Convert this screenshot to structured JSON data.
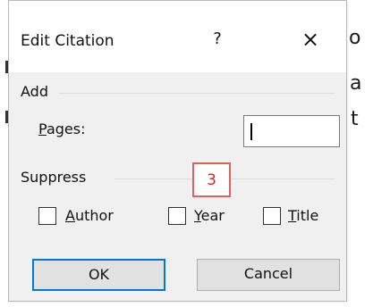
{
  "background": {
    "lines": [
      "o",
      "a",
      "t"
    ]
  },
  "dialog": {
    "title": "Edit Citation",
    "help_glyph": "?",
    "close_glyph": "×",
    "add_group": "Add",
    "pages_label_u": "P",
    "pages_label_rest": "ages:",
    "pages_value": "",
    "suppress_group": "Suppress",
    "checkboxes": [
      {
        "u": "A",
        "rest": "uthor",
        "checked": false
      },
      {
        "u": "Y",
        "rest": "ear",
        "checked": false
      },
      {
        "u": "T",
        "rest": "itle",
        "checked": false
      }
    ],
    "annotation": "3",
    "ok_label": "OK",
    "cancel_label": "Cancel"
  },
  "colors": {
    "dialog_bg": "#f0f0f0",
    "ok_border": "#0078d7",
    "annotation": "#e02020"
  }
}
